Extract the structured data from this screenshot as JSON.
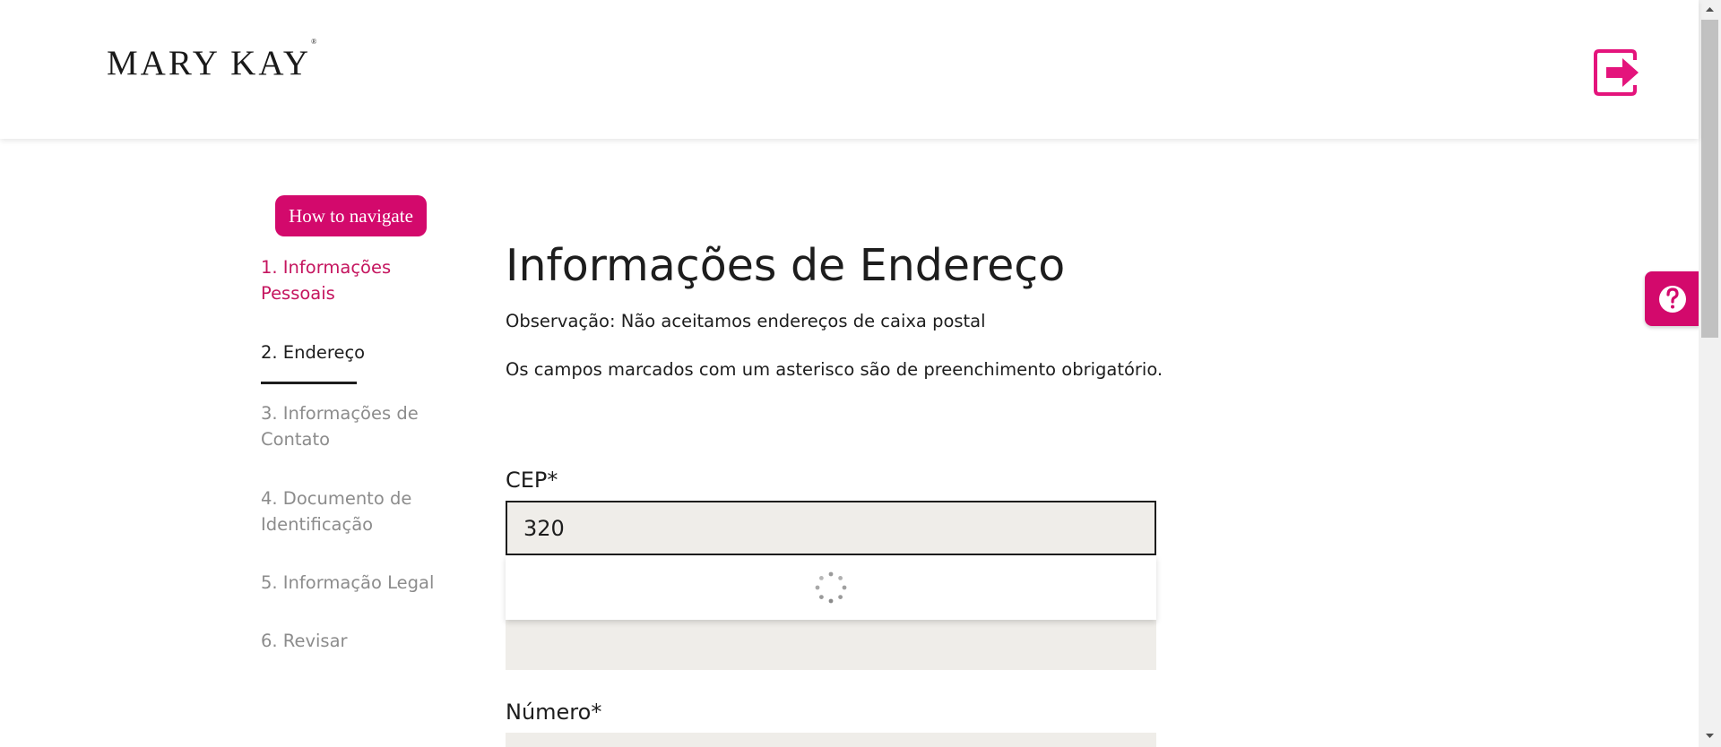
{
  "header": {
    "logo_text": "MARY KAY",
    "logo_mark": "®",
    "logout_icon": "logout-icon",
    "accent_color": "#e4147c"
  },
  "sidebar": {
    "help_button_label": "How to navigate",
    "steps": [
      {
        "label": "1. Informações Pessoais",
        "state": "completed"
      },
      {
        "label": "2. Endereço",
        "state": "active"
      },
      {
        "label": "3. Informações de Contato",
        "state": "pending"
      },
      {
        "label": "4. Documento de Identificação",
        "state": "pending"
      },
      {
        "label": "5. Informação Legal",
        "state": "pending"
      },
      {
        "label": "6. Revisar",
        "state": "pending"
      }
    ]
  },
  "main": {
    "title": "Informações de Endereço",
    "note_po_box": "Observação: Não aceitamos endereços de caixa postal",
    "note_required": "Os campos marcados com um asterisco são de preenchimento obrigatório.",
    "cep_label": "CEP*",
    "cep_value": "320",
    "numero_label": "Número*"
  },
  "help_widget": {
    "icon": "question-icon"
  },
  "colors": {
    "brand": "#d3096c",
    "completed_step": "#c5155f",
    "pending_step": "#8c8c8c",
    "field_bg": "#efede9"
  }
}
